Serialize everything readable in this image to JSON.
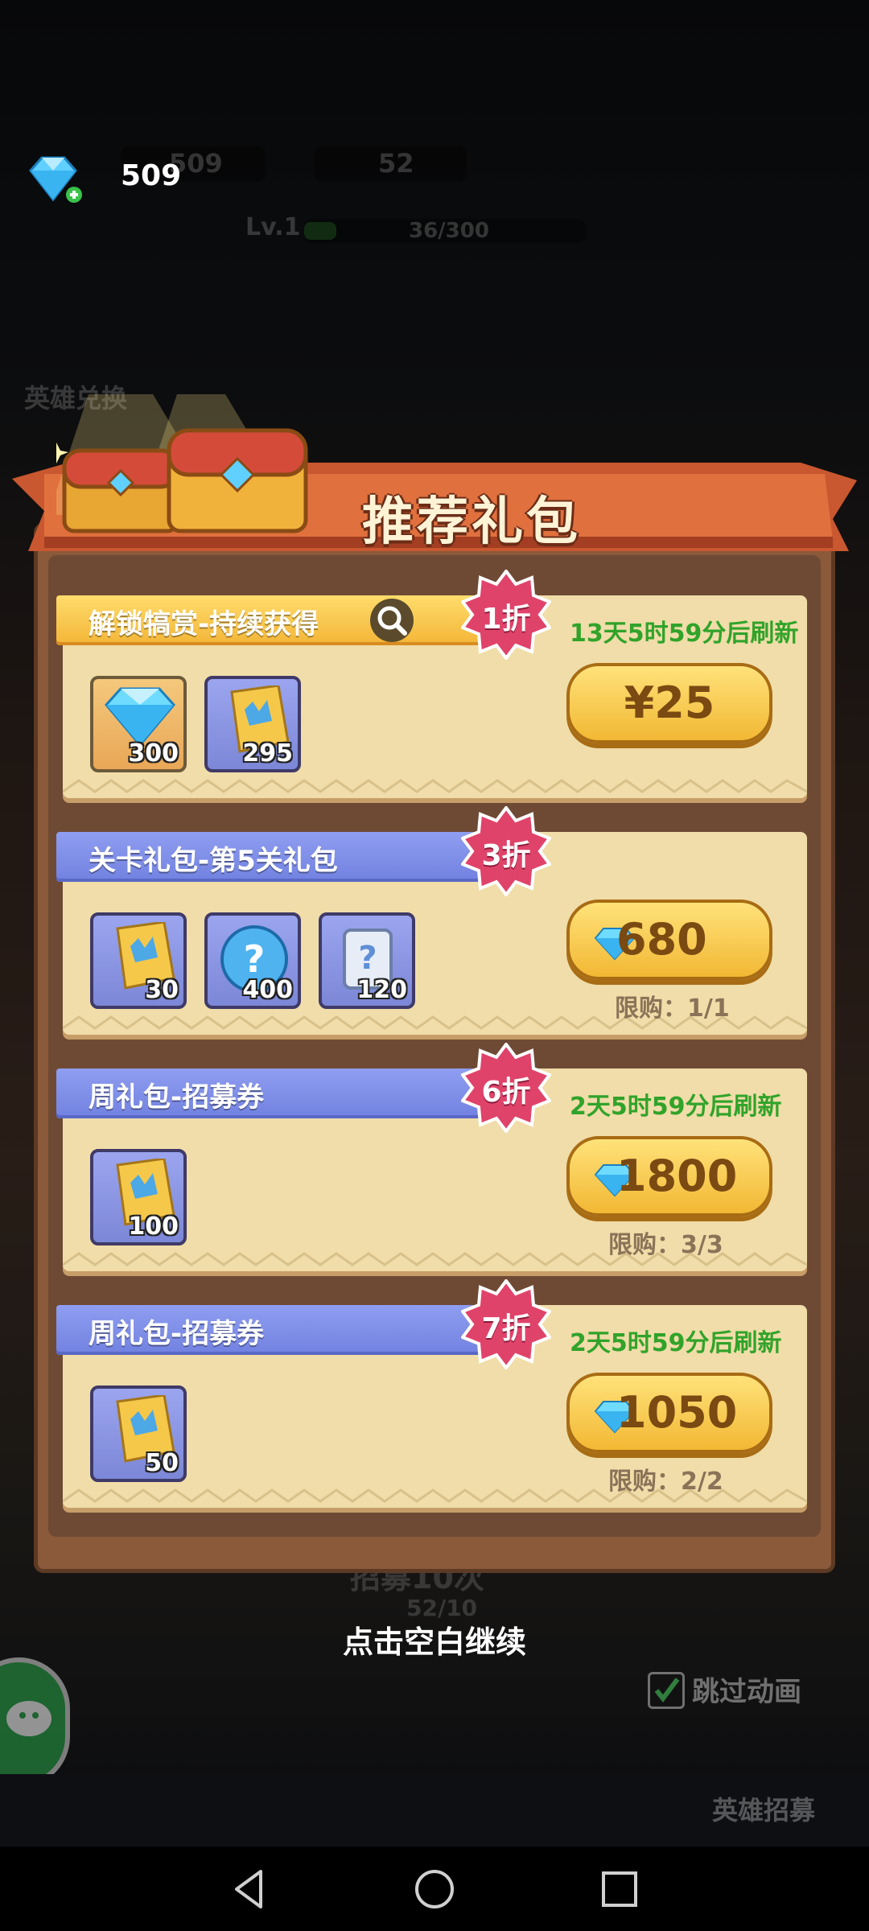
{
  "hud": {
    "gems": "509",
    "gems_shadow": "509",
    "tickets": "52",
    "level": "Lv.1",
    "exp": "36/300"
  },
  "side": {
    "hero_exchange": "英雄兑换"
  },
  "panel": {
    "title": "推荐礼包"
  },
  "packs": [
    {
      "title": "解锁犒赏-持续获得",
      "discount": "1折",
      "refresh": "13天5时59分后刷新",
      "price": "¥25",
      "limit": "",
      "items": [
        {
          "icon": "diamond-icon",
          "qty": "300"
        },
        {
          "icon": "ticket-icon",
          "qty": "295"
        }
      ]
    },
    {
      "title": "关卡礼包-第5关礼包",
      "discount": "3折",
      "refresh": "",
      "price": "680",
      "limit": "限购：1/1",
      "items": [
        {
          "icon": "ticket-icon",
          "qty": "30"
        },
        {
          "icon": "mystery-orb-icon",
          "qty": "400"
        },
        {
          "icon": "scroll-icon",
          "qty": "120"
        }
      ]
    },
    {
      "title": "周礼包-招募券",
      "discount": "6折",
      "refresh": "2天5时59分后刷新",
      "price": "1800",
      "limit": "限购：3/3",
      "items": [
        {
          "icon": "ticket-icon",
          "qty": "100"
        }
      ]
    },
    {
      "title": "周礼包-招募券",
      "discount": "7折",
      "refresh": "2天5时59分后刷新",
      "price": "1050",
      "limit": "限购：2/2",
      "items": [
        {
          "icon": "ticket-icon",
          "qty": "50"
        }
      ]
    }
  ],
  "underlay": {
    "recruit": "招募10次",
    "recruit_count": "52/10",
    "hero_recruit": "英雄招募"
  },
  "continue_hint": "点击空白继续",
  "skip_animation": "跳过动画",
  "colors": {
    "refresh_green": "#31a32a",
    "panel_brown": "#8a5a3a",
    "card_cream": "#f0dda9"
  }
}
